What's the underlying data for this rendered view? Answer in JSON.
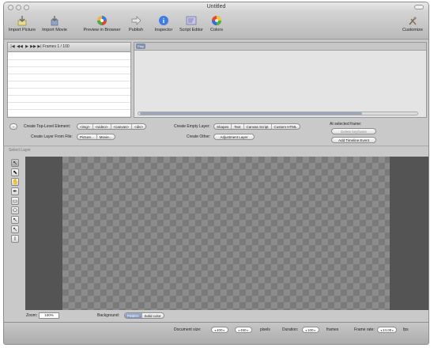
{
  "window": {
    "title": "Untitled"
  },
  "toolbar": {
    "import_picture": "Import Picture",
    "import_movie": "Import Movie",
    "preview_in_browser": "Preview in Browser",
    "publish": "Publish",
    "inspector": "Inspector",
    "script_editor": "Script Editor",
    "colors": "Colors",
    "customize": "Customize"
  },
  "timeline": {
    "frames_label": "Frames 1 / 100",
    "playhead_label": "Play"
  },
  "controls": {
    "create_top_level_label": "Create Top-Level Element:",
    "top_level_elements": [
      "<img>",
      "<video>",
      "<canvas>",
      "<div>"
    ],
    "create_empty_layer_label": "Create Empty Layer:",
    "empty_layer_types": [
      "Shapes",
      "Text",
      "Canvas Script",
      "Custom HTML"
    ],
    "at_selected_frame_label": "At selected frame:",
    "delete_keyframe": "Delete keyframe",
    "add_timeline_event": "Add Timeline Event",
    "create_layer_from_file_label": "Create Layer From File:",
    "file_buttons": [
      "Picture...",
      "Movie..."
    ],
    "create_other_label": "Create Other:",
    "adjustment_layer": "Adjustment Layer"
  },
  "canvas": {
    "select_layer_label": "Select Layer",
    "zoom_label": "Zoom:",
    "zoom_value": "100%",
    "background_label": "Background:",
    "background_options": [
      "Pattern",
      "Solid color"
    ],
    "background_selected": "Pattern"
  },
  "status": {
    "document_size_label": "Document size:",
    "width_value": "400",
    "height_value": "450",
    "pixels_unit": "pixels",
    "duration_label": "Duration:",
    "duration_value": "100",
    "frames_unit": "frames",
    "frame_rate_label": "Frame rate:",
    "frame_rate_value": "24.00",
    "fps_unit": "fps"
  },
  "icons": {
    "import_picture": "import-picture-icon",
    "import_movie": "import-movie-icon",
    "preview": "preview-browser-icon",
    "publish": "publish-icon",
    "inspector": "info-icon",
    "script_editor": "script-editor-icon",
    "colors": "color-wheel-icon",
    "customize": "tools-icon",
    "tools": [
      "arrow-tool-icon",
      "direct-select-tool-icon",
      "hand-tool-icon",
      "pen-tool-icon",
      "rectangle-tool-icon",
      "ellipse-tool-icon",
      "pointer-add-tool-icon",
      "pointer-remove-tool-icon",
      "text-tool-icon"
    ]
  },
  "colors": {
    "window_chrome": "#c9c9c9",
    "stage_background": "#545454",
    "checker_light": "#8c8c8c",
    "checker_dark": "#7a7a7a",
    "accent": "#7f94bb"
  }
}
